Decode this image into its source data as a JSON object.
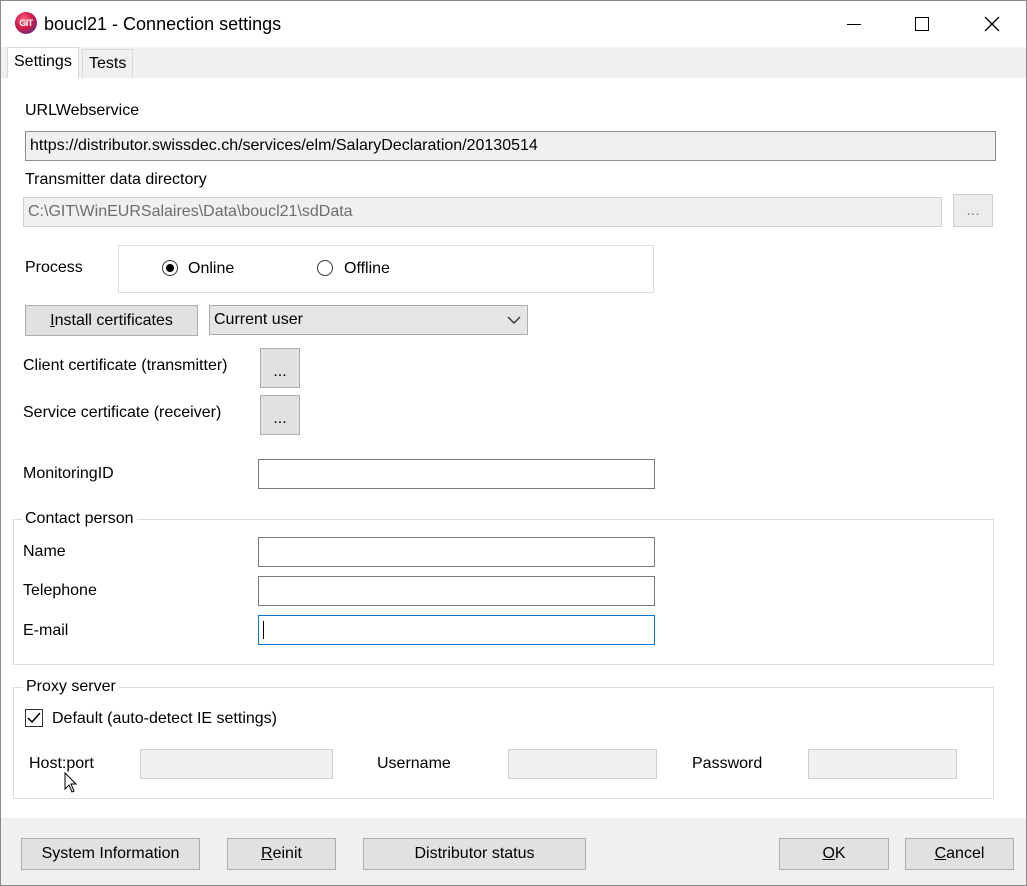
{
  "window": {
    "title": "boucl21 - Connection settings",
    "app_icon_text": "GIT"
  },
  "tabs": [
    {
      "label": "Settings"
    },
    {
      "label": "Tests"
    }
  ],
  "url": {
    "label": "URLWebservice",
    "value": "https://distributor.swissdec.ch/services/elm/SalaryDeclaration/20130514"
  },
  "transmitter": {
    "label": "Transmitter data directory",
    "value": "C:\\GIT\\WinEURSalaires\\Data\\boucl21\\sdData",
    "browse_label": "..."
  },
  "process": {
    "label": "Process",
    "options": [
      {
        "label": "Online",
        "selected": true
      },
      {
        "label": "Offline",
        "selected": false
      }
    ]
  },
  "certificates": {
    "install_label_pre": "",
    "install_label_ul": "I",
    "install_label_post": "nstall certificates",
    "store_value": "Current user",
    "client_label": "Client certificate (transmitter)",
    "client_button": "...",
    "service_label": "Service certificate (receiver)",
    "service_button": "..."
  },
  "monitoring": {
    "label": "MonitoringID",
    "value": ""
  },
  "contact": {
    "group_label": "Contact person",
    "name_label": "Name",
    "name_value": "",
    "telephone_label": "Telephone",
    "telephone_value": "",
    "email_label": "E-mail",
    "email_value": ""
  },
  "proxy": {
    "group_label": "Proxy server",
    "default_label": "Default (auto-detect IE settings)",
    "default_checked": true,
    "host_label": "Host:port",
    "host_value": "",
    "username_label": "Username",
    "username_value": "",
    "password_label": "Password",
    "password_value": ""
  },
  "footer": {
    "system_info": "System Information",
    "reinit_ul": "R",
    "reinit_rest": "einit",
    "distributor_status": "Distributor status",
    "ok_ul": "O",
    "ok_rest": "K",
    "cancel_ul": "C",
    "cancel_rest": "ancel"
  }
}
